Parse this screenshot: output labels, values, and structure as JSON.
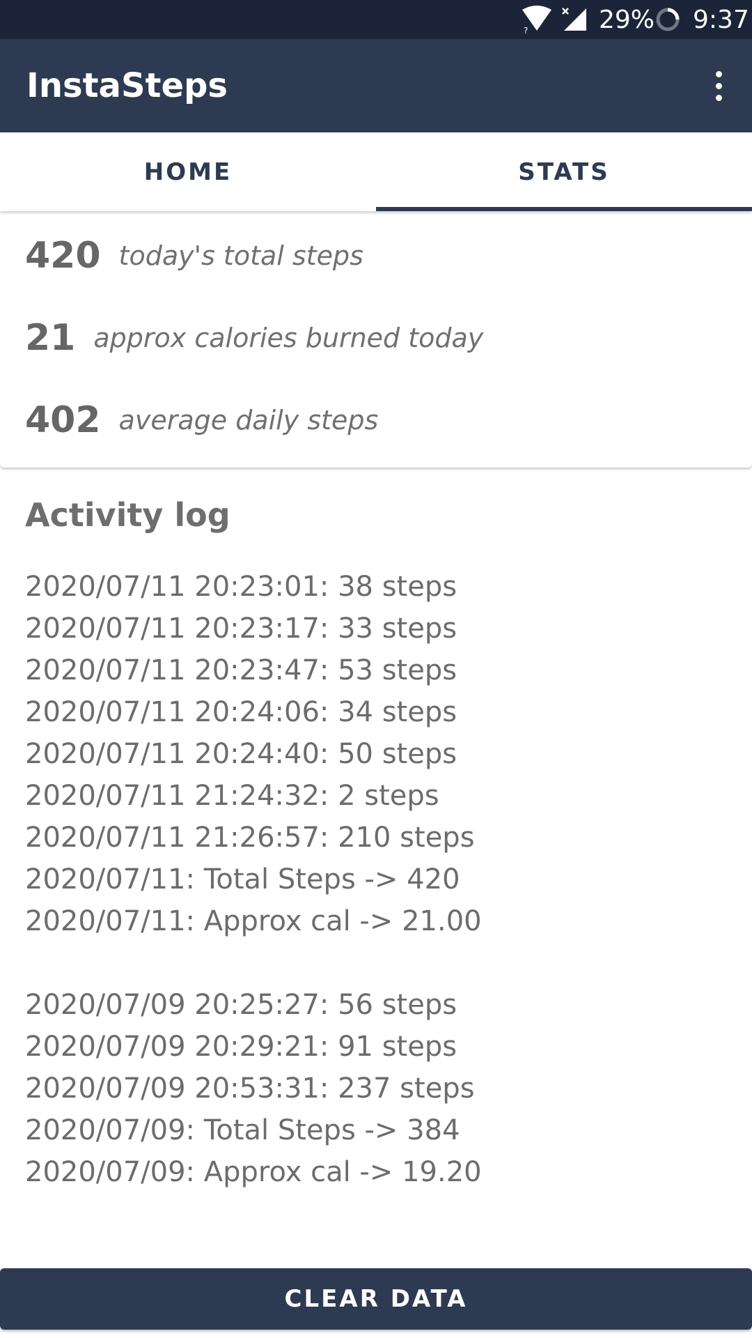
{
  "status_bar": {
    "battery": "29%",
    "time": "9:37",
    "icons": [
      "wifi-icon",
      "signal-no-service-icon",
      "battery-saver-ring-icon"
    ]
  },
  "app_bar": {
    "title": "InstaSteps",
    "menu_icon": "more-vertical-icon"
  },
  "tabs": [
    {
      "label": "HOME",
      "selected": false
    },
    {
      "label": "STATS",
      "selected": true
    }
  ],
  "stats": [
    {
      "value": "420",
      "label": "today's total steps"
    },
    {
      "value": "21",
      "label": "approx calories burned today"
    },
    {
      "value": "402",
      "label": "average daily steps"
    }
  ],
  "activity_log": {
    "title": "Activity log",
    "entries": [
      "2020/07/11 20:23:01: 38 steps",
      "2020/07/11 20:23:17: 33 steps",
      "2020/07/11 20:23:47: 53 steps",
      "2020/07/11 20:24:06: 34 steps",
      "2020/07/11 20:24:40: 50 steps",
      "2020/07/11 21:24:32: 2 steps",
      "2020/07/11 21:26:57: 210 steps",
      "2020/07/11: Total Steps -> 420",
      "2020/07/11: Approx cal -> 21.00",
      "",
      "2020/07/09 20:25:27: 56 steps",
      "2020/07/09 20:29:21: 91 steps",
      "2020/07/09 20:53:31: 237 steps",
      "2020/07/09: Total Steps -> 384",
      "2020/07/09: Approx cal -> 19.20"
    ]
  },
  "clear_button": {
    "label": "CLEAR DATA"
  },
  "colors": {
    "status_bar": "#1b2438",
    "primary": "#2d3a52",
    "text_gray": "#6c6c6c"
  }
}
